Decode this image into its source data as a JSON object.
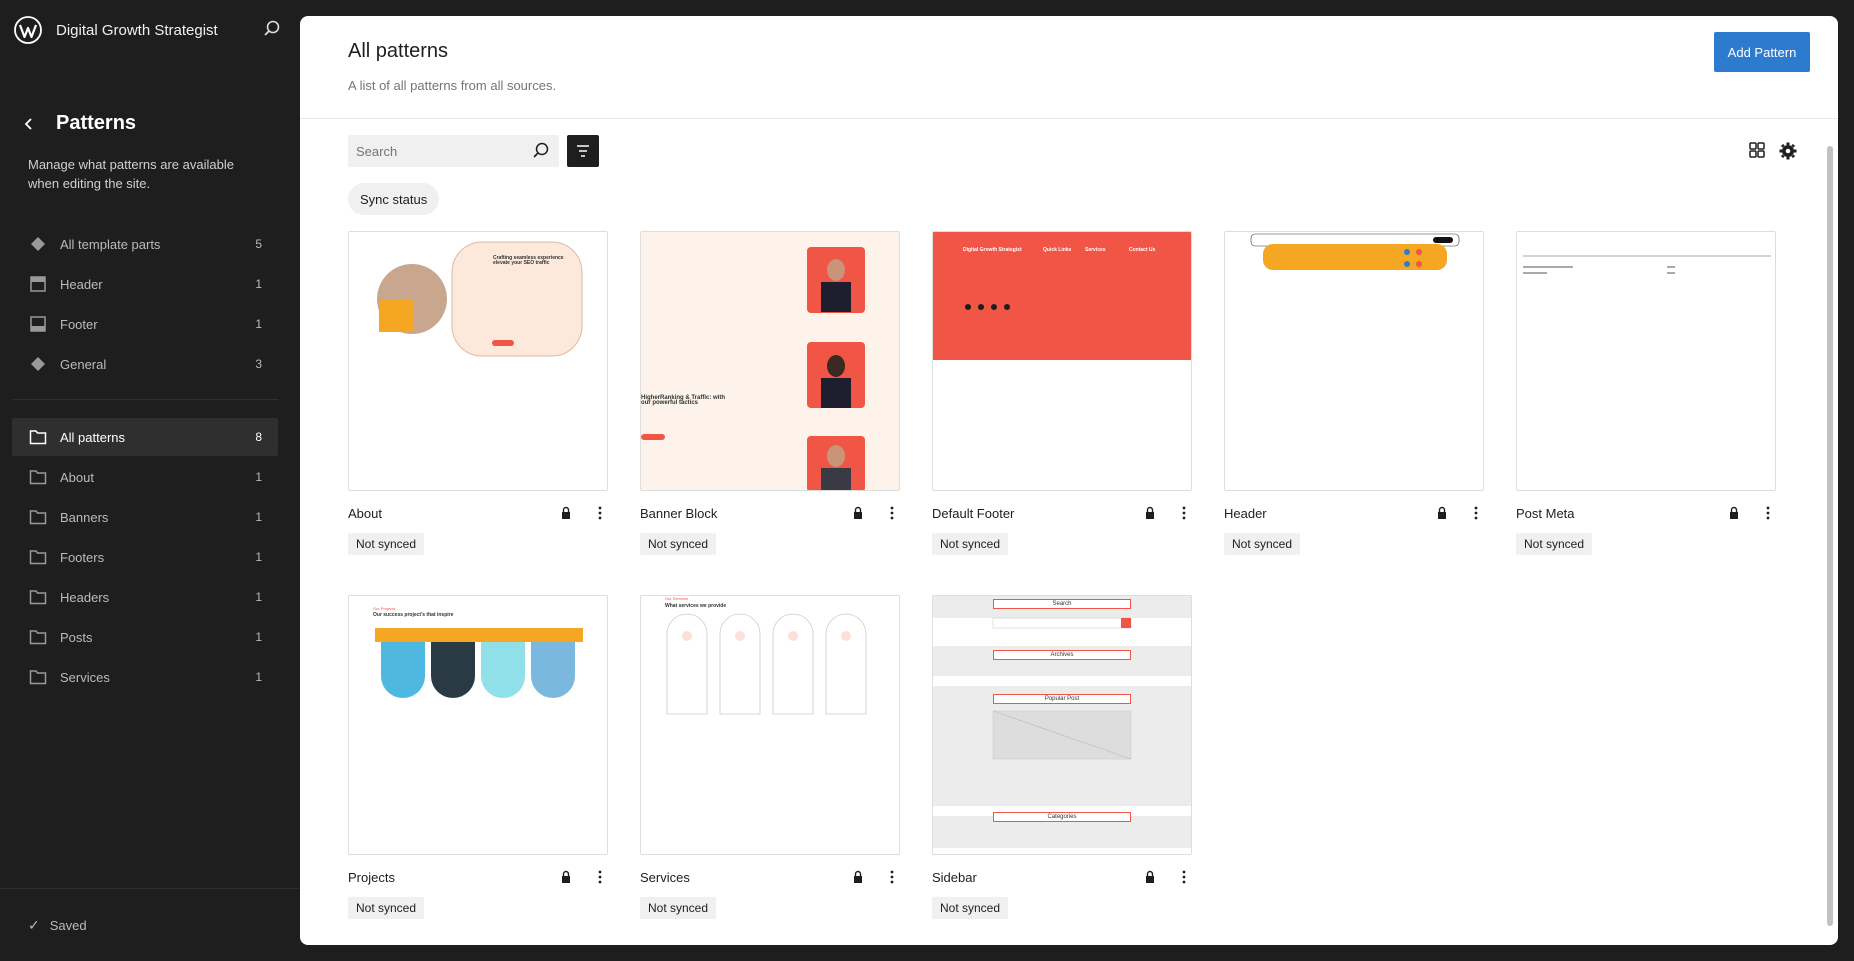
{
  "site": {
    "title": "Digital Growth Strategist"
  },
  "sidebar": {
    "title": "Patterns",
    "description": "Manage what patterns are available when editing the site.",
    "template_parts": [
      {
        "label": "All template parts",
        "count": "5",
        "icon": "template-parts-icon"
      },
      {
        "label": "Header",
        "count": "1",
        "icon": "header-icon"
      },
      {
        "label": "Footer",
        "count": "1",
        "icon": "footer-icon"
      },
      {
        "label": "General",
        "count": "3",
        "icon": "template-parts-icon"
      }
    ],
    "categories": [
      {
        "label": "All patterns",
        "count": "8",
        "active": true
      },
      {
        "label": "About",
        "count": "1"
      },
      {
        "label": "Banners",
        "count": "1"
      },
      {
        "label": "Footers",
        "count": "1"
      },
      {
        "label": "Headers",
        "count": "1"
      },
      {
        "label": "Posts",
        "count": "1"
      },
      {
        "label": "Services",
        "count": "1"
      }
    ],
    "footer_status": "Saved"
  },
  "main": {
    "title": "All patterns",
    "subtitle": "A list of all patterns from all sources.",
    "add_button": "Add Pattern",
    "search_placeholder": "Search",
    "filter_chip": "Sync status",
    "patterns": [
      {
        "title": "About",
        "status": "Not synced"
      },
      {
        "title": "Banner Block",
        "status": "Not synced"
      },
      {
        "title": "Default Footer",
        "status": "Not synced"
      },
      {
        "title": "Header",
        "status": "Not synced"
      },
      {
        "title": "Post Meta",
        "status": "Not synced"
      },
      {
        "title": "Projects",
        "status": "Not synced"
      },
      {
        "title": "Services",
        "status": "Not synced"
      },
      {
        "title": "Sidebar",
        "status": "Not synced"
      }
    ]
  },
  "previews": {
    "about_heading": "Crafting seamless experience elevate your SEO traffic",
    "banner_heading": "HigherRanking & Traffic: with our powerful tactics",
    "footer_brand": "Digital Growth Strategist",
    "footer_cols": [
      "Quick Links",
      "Services",
      "Contact Us"
    ],
    "projects_kicker": "Our Projects",
    "projects_heading": "Our success project's that inspire",
    "services_kicker": "Our Services",
    "services_heading": "What services we provide",
    "sidebar_labels": [
      "Search",
      "Archives",
      "Popular Post",
      "Categories"
    ]
  },
  "colors": {
    "accent": "#2c7bcf",
    "brand_red": "#f05545",
    "brand_orange": "#f5a623"
  }
}
